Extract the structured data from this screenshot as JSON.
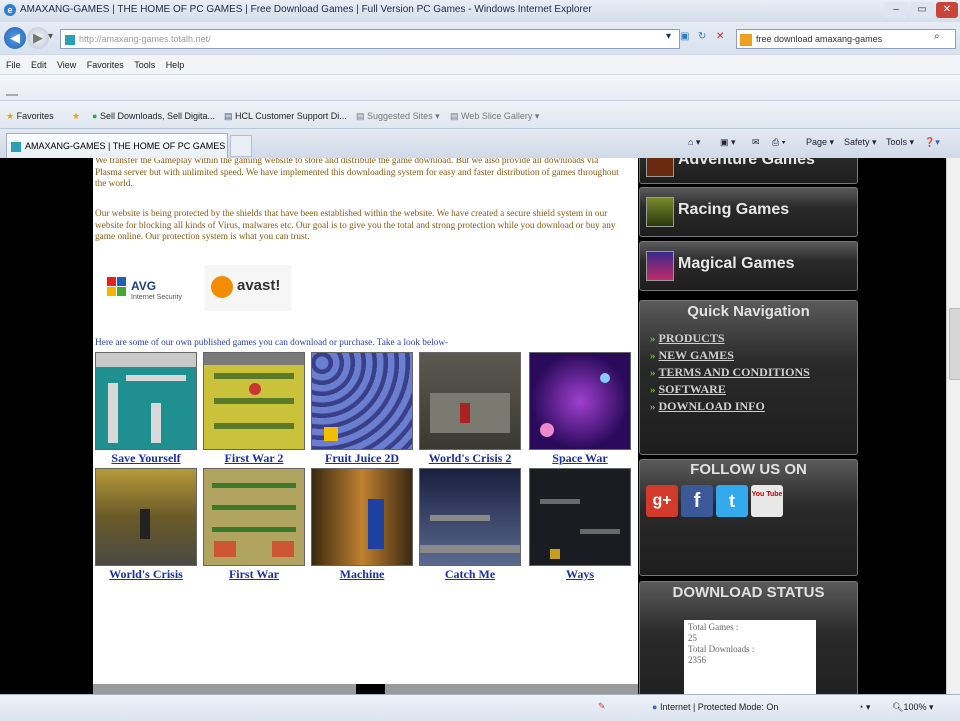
{
  "window": {
    "title": "AMAXANG-GAMES | THE HOME OF PC GAMES | Free Download Games | Full Version PC Games - Windows Internet Explorer"
  },
  "address": {
    "url": "http://amaxang-games.totalh.net/",
    "search_text": "free download amaxang-games"
  },
  "menu": [
    "File",
    "Edit",
    "View",
    "Favorites",
    "Tools",
    "Help"
  ],
  "favorites": {
    "label": "Favorites",
    "items": [
      "Sell Downloads, Sell Digita...",
      "HCL Customer Support Di...",
      "Suggested Sites ▾",
      "Web Slice Gallery ▾"
    ]
  },
  "tab": {
    "label": "AMAXANG-GAMES | THE HOME OF PC GAMES |..."
  },
  "commands": [
    "Page ▾",
    "Safety ▾",
    "Tools ▾"
  ],
  "page": {
    "intro": "We transfer the Gameplay within the gaming website to store and distribute the game download. But we also provide all downloads via Plasma server but with unlimited speed. We have implemented this downloading system for easy and faster distribution of games throughout the world.",
    "protection": "Our website is being protected by the shields that have been established within the website. We have created a secure shield system in our website for blocking all kinds of Virus, malwares etc. Our goal is to give you the total and strong protection while you download or buy any game online. Our protection system is what you can trust.",
    "avg_brand": "AVG",
    "avg_sub": "Internet Security",
    "avast_brand": "avast!",
    "games_intro": "Here are some of our own published games you can download or purchase. Take a look below-",
    "games": [
      "Save Yourself",
      "First War 2",
      "Fruit Juice 2D",
      "World's Crisis 2",
      "Space War",
      "World's Crisis",
      "First War",
      "Machine",
      "Catch Me",
      "Ways"
    ]
  },
  "sidebar": {
    "top_partial": "Adventure Games",
    "categories": [
      "Racing Games",
      "Magical Games"
    ],
    "quick_nav_title": "Quick Navigation",
    "quick_nav": [
      "PRODUCTS",
      "NEW GAMES",
      "TERMS AND CONDITIONS",
      "SOFTWARE",
      "DOWNLOAD INFO"
    ],
    "follow_title": "FOLLOW US ON",
    "social": [
      "g+",
      "f",
      "t",
      "You Tube"
    ],
    "download_title": "DOWNLOAD STATUS",
    "total_games_label": "Total Games :",
    "total_games": "25",
    "total_downloads_label": "Total Downloads :",
    "total_downloads": "2356"
  },
  "status": {
    "zone": "Internet | Protected Mode: On",
    "zoom": "100%"
  }
}
